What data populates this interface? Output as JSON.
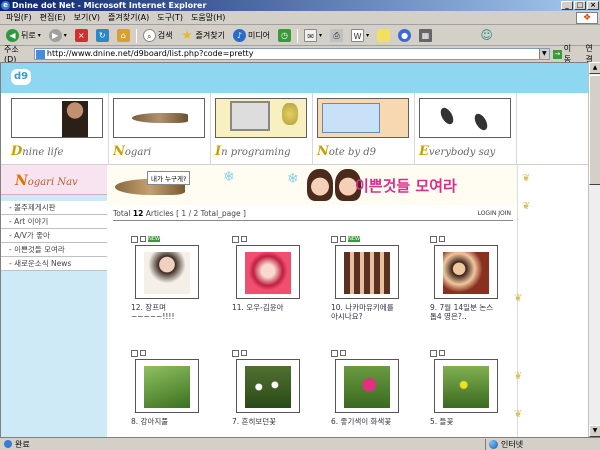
{
  "window": {
    "title": "Dnine dot Net - Microsoft Internet Explorer",
    "buttons": [
      "_",
      "□",
      "×"
    ]
  },
  "menu": [
    "파일(F)",
    "편집(E)",
    "보기(V)",
    "즐겨찾기(A)",
    "도구(T)",
    "도움말(H)"
  ],
  "toolbar": {
    "back": "뒤로",
    "search": "검색",
    "favorites": "즐겨찾기",
    "media": "미디어"
  },
  "address": {
    "label": "주소(D)",
    "url": "http://www.dnine.net/d9board/list.php?code=pretty",
    "go": "이동",
    "links": "연결"
  },
  "site": {
    "logo": "d9",
    "nav": [
      {
        "cap": "D",
        "rest": "nine life"
      },
      {
        "cap": "N",
        "rest": "ogari"
      },
      {
        "cap": "I",
        "rest": "n programing"
      },
      {
        "cap": "N",
        "rest": "ote by d9"
      },
      {
        "cap": "E",
        "rest": "verybody say"
      }
    ],
    "sidebar_head": {
      "cap": "N",
      "rest": "ogari Nav"
    },
    "sidebar_items": [
      "- 볼주제게시판",
      "- Art 이야기",
      "- A/V가 좋아",
      "- 이쁜것들 모여라",
      "- 새로운소식 News"
    ],
    "banner": {
      "speech": "내가 누구게?",
      "title": "이쁜것들 모여라"
    },
    "stats": {
      "total_prefix": "Total",
      "total": "12",
      "articles": "Articles",
      "page": "[ 1 / 2 Total_page ]",
      "login": "LOGIN  JOIN"
    },
    "cards": [
      {
        "caption": "12. 장프며 ~~~~~!!!!",
        "new": "NEW"
      },
      {
        "caption": "11. 오우-김윤아",
        "new": ""
      },
      {
        "caption": "10. 나카마유키에를 아시나요?",
        "new": "NEW"
      },
      {
        "caption": "9. 7월 14일분 논스톱4 영은?..",
        "new": ""
      },
      {
        "caption": "8. 강아지풀",
        "new": ""
      },
      {
        "caption": "7. 흔히보던꽃",
        "new": ""
      },
      {
        "caption": "6. 좋기색이 화색꽃",
        "new": ""
      },
      {
        "caption": "5. 들꽃",
        "new": ""
      }
    ]
  },
  "status": {
    "left": "완료",
    "zone": "인터넷"
  }
}
